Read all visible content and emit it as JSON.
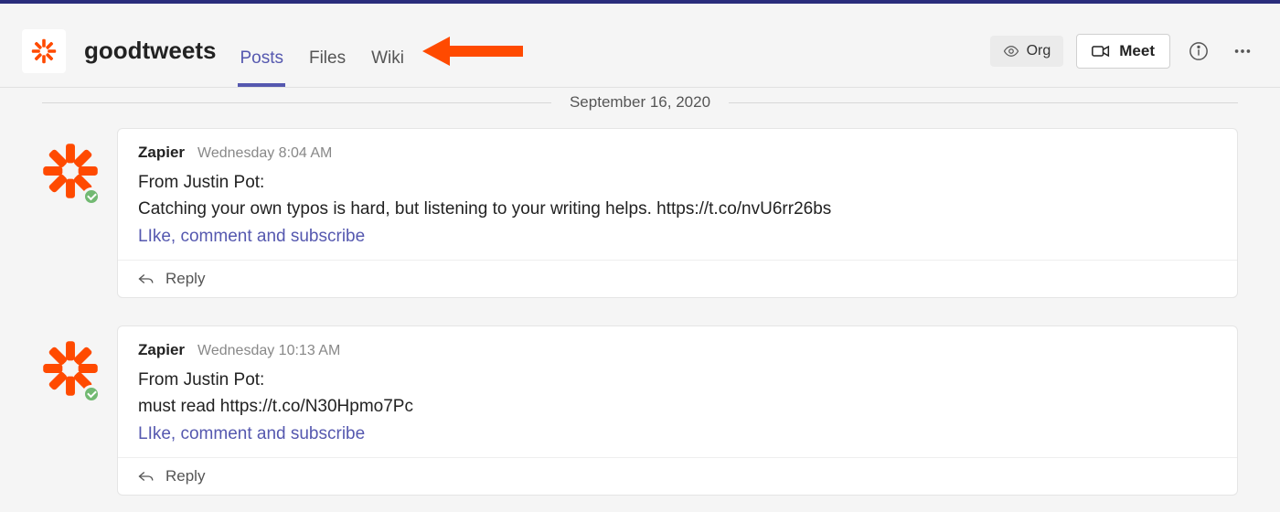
{
  "header": {
    "channel_name": "goodtweets",
    "tabs": [
      "Posts",
      "Files",
      "Wiki"
    ],
    "active_tab_index": 0,
    "org_label": "Org",
    "meet_label": "Meet"
  },
  "date_divider": "September 16, 2020",
  "posts": [
    {
      "sender": "Zapier",
      "timestamp": "Wednesday 8:04 AM",
      "line1": "From Justin Pot:",
      "line2": "Catching your own typos is hard, but listening to your writing helps. https://t.co/nvU6rr26bs",
      "cta": "LIke, comment and subscribe",
      "reply_label": "Reply"
    },
    {
      "sender": "Zapier",
      "timestamp": "Wednesday 10:13 AM",
      "line1": "From Justin Pot:",
      "line2": "must read https://t.co/N30Hpmo7Pc",
      "cta": "LIke, comment and subscribe",
      "reply_label": "Reply"
    }
  ],
  "colors": {
    "accent": "#5558af",
    "zapier_orange": "#ff4a00",
    "arrow": "#ff4a00"
  }
}
